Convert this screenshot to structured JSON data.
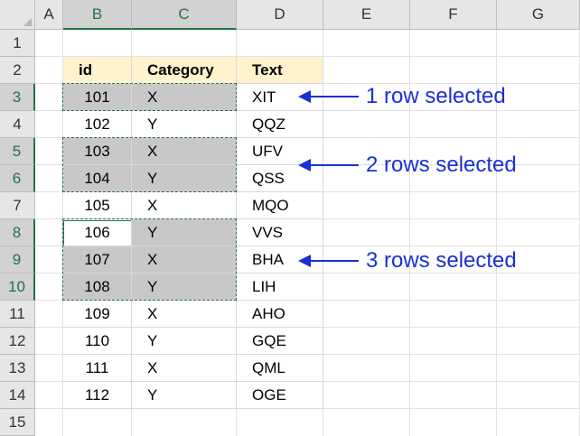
{
  "columns": [
    "A",
    "B",
    "C",
    "D",
    "E",
    "F",
    "G"
  ],
  "selected_columns": [
    "B",
    "C"
  ],
  "rows": [
    "1",
    "2",
    "3",
    "4",
    "5",
    "6",
    "7",
    "8",
    "9",
    "10",
    "11",
    "12",
    "13",
    "14",
    "15"
  ],
  "selected_rows": [
    "3",
    "5",
    "6",
    "8",
    "9",
    "10"
  ],
  "table": {
    "headers": [
      "id",
      "Category",
      "Text"
    ],
    "rows": [
      [
        "101",
        "X",
        "XIT"
      ],
      [
        "102",
        "Y",
        "QQZ"
      ],
      [
        "103",
        "X",
        "UFV"
      ],
      [
        "104",
        "Y",
        "QSS"
      ],
      [
        "105",
        "X",
        "MQO"
      ],
      [
        "106",
        "Y",
        "VVS"
      ],
      [
        "107",
        "X",
        "BHA"
      ],
      [
        "108",
        "Y",
        "LIH"
      ],
      [
        "109",
        "X",
        "AHO"
      ],
      [
        "110",
        "Y",
        "GQE"
      ],
      [
        "111",
        "X",
        "QML"
      ],
      [
        "112",
        "Y",
        "OGE"
      ]
    ]
  },
  "annotations": [
    "1 row selected",
    "2 rows selected",
    "3 rows selected"
  ],
  "colors": {
    "header_fill": "#fff2cc",
    "selection_fill": "#c8c8c8",
    "selection_border": "#2f6e45",
    "annotation": "#1a2fd6"
  }
}
